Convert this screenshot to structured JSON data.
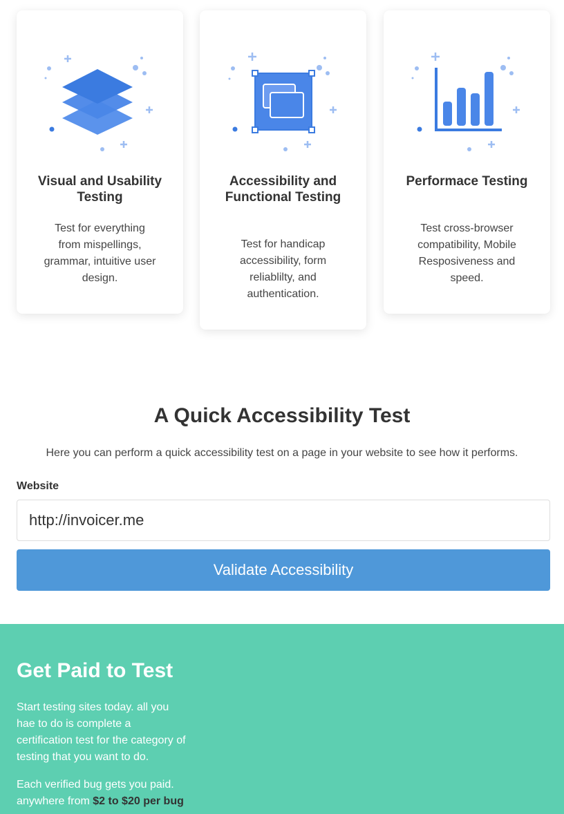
{
  "features": [
    {
      "icon": "layers-icon",
      "title": "Visual and Usability Testing",
      "description": "Test for everything from mispellings, grammar, intuitive user design."
    },
    {
      "icon": "windows-icon",
      "title": "Accessibility and Functional Testing",
      "description": "Test for handicap accessibility, form reliablilty, and authentication."
    },
    {
      "icon": "bar-chart-icon",
      "title": "Performace Testing",
      "description": "Test cross-browser compatibility, Mobile Resposiveness and speed."
    }
  ],
  "quick_test": {
    "title": "A Quick Accessibility Test",
    "description": "Here you can perform a quick accessibility test on a page in your website to see how it performs.",
    "field_label": "Website",
    "website_value": "http://invoicer.me",
    "button_label": "Validate Accessibility"
  },
  "get_paid": {
    "title": "Get Paid to Test",
    "paragraph1": "Start testing sites today. all you hae to do is complete a certification test for the category of testing that you want to do.",
    "paragraph2_prefix": "Each verified bug gets you paid. anywhere from ",
    "paragraph2_bold": "$2 to $20 per bug"
  },
  "colors": {
    "icon_blue": "#3b7be0",
    "icon_light": "#6d9cf0",
    "button_blue": "#4f98d9",
    "section_green": "#5dcfb1"
  }
}
